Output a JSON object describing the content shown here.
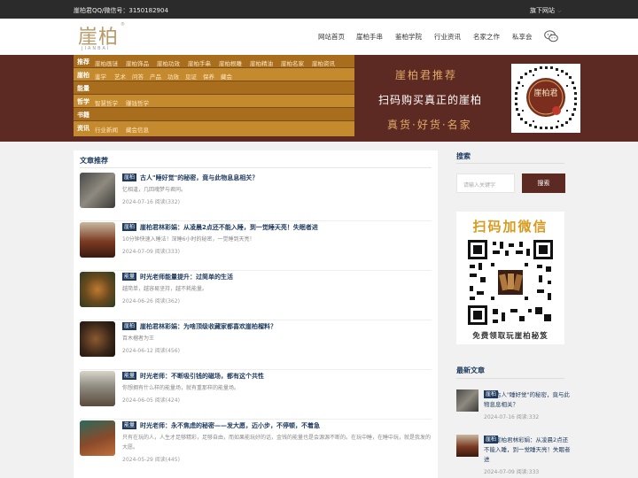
{
  "topbar": {
    "contact": "崖柏君QQ/微信号：3150182904",
    "site_menu": "旗下网站"
  },
  "header": {
    "logo_cn": "崖柏",
    "logo_en": "JIANBAI",
    "nav": [
      "网站首页",
      "崖柏手串",
      "鉴柏学院",
      "行业资讯",
      "名家之作",
      "私享会"
    ]
  },
  "banner": {
    "categories": [
      {
        "head": "推荐",
        "links": [
          "崖柏画谜",
          "崖柏饰品",
          "崖柏功效",
          "崖柏手串",
          "崖柏根雕",
          "崖柏精油",
          "崖柏名家",
          "崖柏资讯"
        ]
      },
      {
        "head": "崖柏",
        "links": [
          "鉴学",
          "艺术",
          "问答",
          "产品",
          "功效",
          "见证",
          "保养",
          "藏会"
        ]
      },
      {
        "head": "能量",
        "links": []
      },
      {
        "head": "哲学",
        "links": [
          "智慧哲学",
          "赚钱哲学"
        ]
      },
      {
        "head": "书籍",
        "links": []
      },
      {
        "head": "资讯",
        "links": [
          "行业新闻",
          "藏会信息"
        ]
      }
    ],
    "promo_title": "崖柏君推荐",
    "promo_line": "扫码购买真正的崖柏",
    "promo_tags": "真货·好货·名家",
    "qr_caption": "崖柏君"
  },
  "articles": {
    "title": "文章推荐",
    "items": [
      {
        "tag": "崖柏",
        "title": "古人\"睡好觉\"的秘密，竟与此物息息相关？",
        "excerpt": "忆相逢，几回魂梦与君同。",
        "meta": "2024-07-16 阅读(332)",
        "thumb": "#6f6a62"
      },
      {
        "tag": "崖柏",
        "title": "崖柏君林彩娟：从凌晨2点还不能入睡，到一觉睡天亮！失眠者进",
        "excerpt": "10分钟快速入睡法！深睡6小时的秘密，一觉睡到天亮！",
        "meta": "2024-07-09 阅读(333)",
        "thumb": "#7a3a22"
      },
      {
        "tag": "能量",
        "title": "时光老师能量提升：过简单的生活",
        "excerpt": "越简单，越容易坚持，越不耗能量。",
        "meta": "2024-06-26 阅读(362)",
        "thumb": "#6a4a1e"
      },
      {
        "tag": "崖柏",
        "title": "崖柏君林彩娟：为啥顶级收藏家都喜欢崖柏榴料？",
        "excerpt": "百木榴者为王",
        "meta": "2024-06-12 阅读(456)",
        "thumb": "#3a2618"
      },
      {
        "tag": "能量",
        "title": "时光老师：不断吸引钱的磁场，都有这个共性",
        "excerpt": "你想拥有什么样的能量场，就有重那样的能量场。",
        "meta": "2024-06-05 阅读(424)",
        "thumb": "#8e8a80"
      },
      {
        "tag": "能量",
        "title": "时光老师：永不焦虑的秘密——发大愿，迈小步，不停顿，不着急",
        "excerpt": "只有在玩的人，人生才足够精彩，足够自由，而如果能玩好的话，金钱的能量也是会源源不断的。在玩中睡，在睡中玩，就是我发的大愿。",
        "meta": "2024-05-29 阅读(445)",
        "thumb": "#8a4a2a"
      }
    ]
  },
  "sidebar": {
    "search_title": "搜索",
    "search_placeholder": "请输入关键字",
    "search_button": "搜索",
    "qr_head": "扫码加微信",
    "qr_foot": "免费领取玩崖柏秘笈",
    "latest_title": "最新文章",
    "latest": [
      {
        "tag": "崖柏",
        "title": "古人\"睡好觉\"的秘密，竟与此物息息相关？",
        "meta": "2024-07-16 阅读:332",
        "thumb": "#6f6a62"
      },
      {
        "tag": "崖柏",
        "title": "崖柏君林彩娟：从凌晨2点还不能入睡，到一觉睡天亮！失眠者进",
        "meta": "2024-07-09 阅读:333",
        "thumb": "#7a3a22"
      }
    ]
  },
  "colors": {
    "brand": "#5c2a22",
    "gold": "#c58a2e",
    "link": "#1e3a5f",
    "accent": "#d79a1e"
  }
}
